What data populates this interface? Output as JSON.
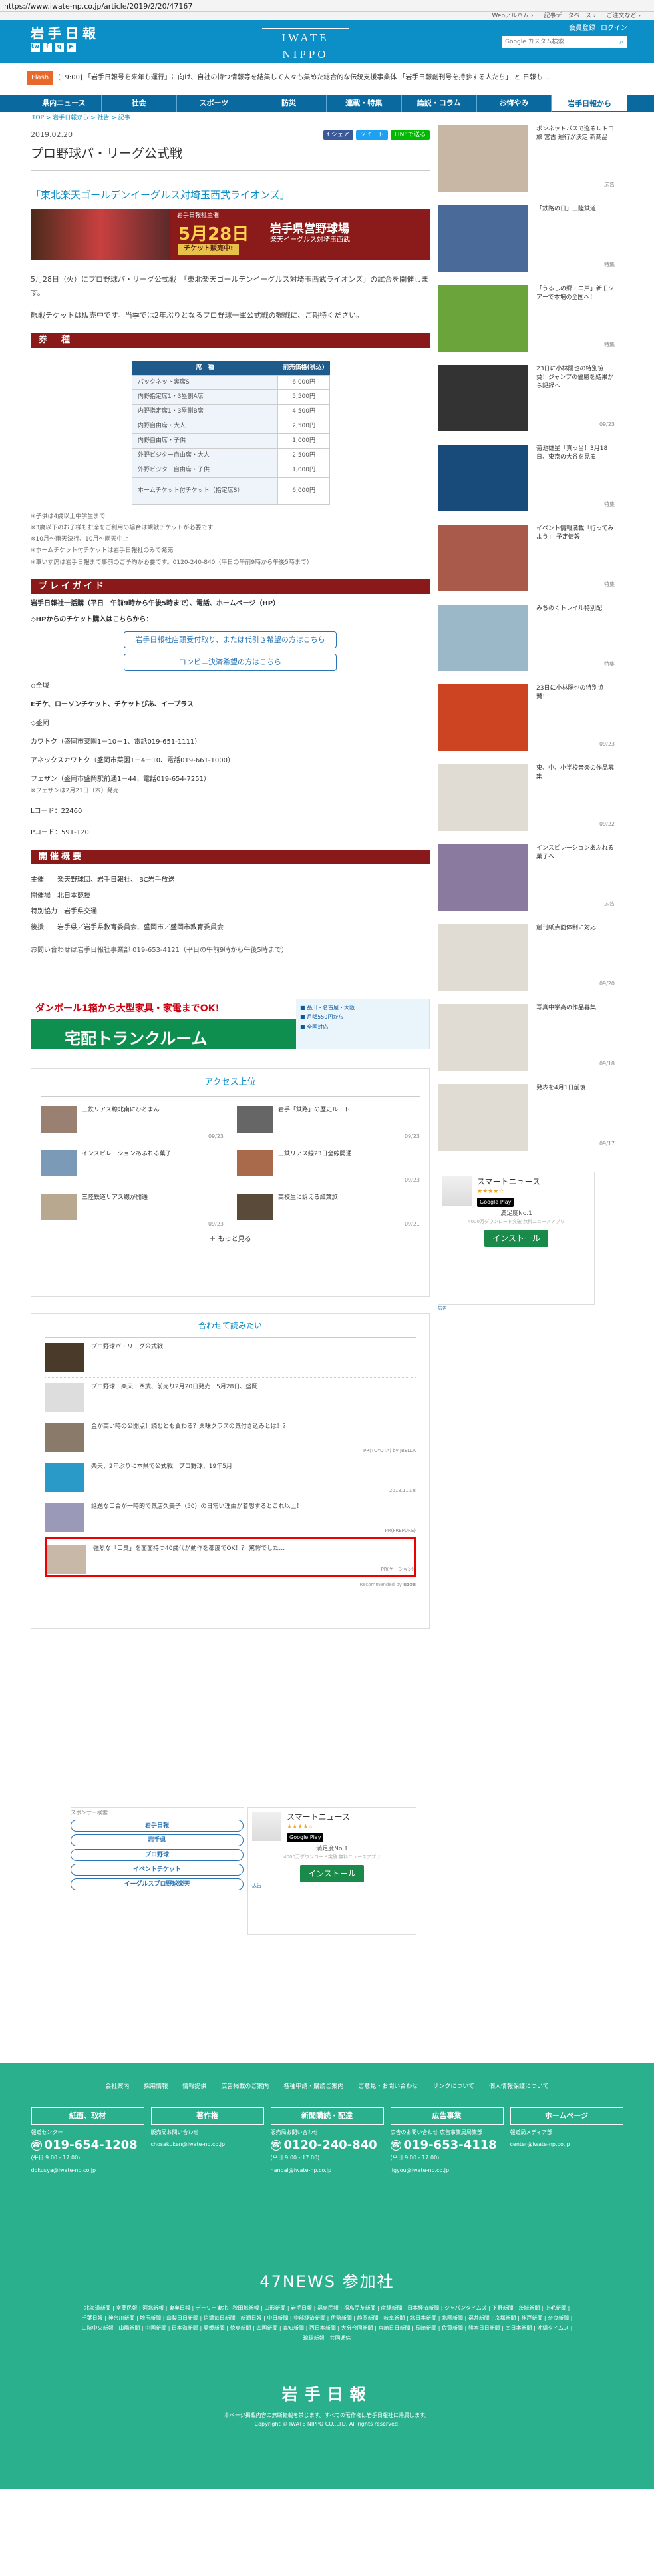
{
  "url": "https://www.iwate-np.co.jp/article/2019/2/20/47167",
  "top_links": [
    "Webアルバム ›",
    "記事データベース ›",
    "ご注文など ›"
  ],
  "header": {
    "logo": "岩手日報",
    "brand": "IWATE NIPPO",
    "brand_date": "2019.02.24 日",
    "links": [
      "会員登録",
      "ログイン"
    ],
    "search_placeholder": "Google カスタム検索",
    "social": [
      "tw",
      "f",
      "g",
      "▶"
    ]
  },
  "flash": {
    "tag": "Flash",
    "text": "[19:00] 「岩手日報号を来年も運行」に向け、自社の持つ情報等を結集して人々も集めた総合的な伝統支援事業体 「岩手日報創刊号を持参する人たち」 と 日報も…"
  },
  "nav": [
    "県内ニュース",
    "社会",
    "スポーツ",
    "防災",
    "連載・特集",
    "論説・コラム",
    "お悔やみ",
    "岩手日報から"
  ],
  "breadcrumb": "TOP > 岩手日報から > 社告 > 記事",
  "article": {
    "date": "2019.02.20",
    "share": [
      "f シェア",
      "ツイート",
      "LINEで送る"
    ],
    "title": "プロ野球パ・リーグ公式戦",
    "subtitle": "「東北楽天ゴールデンイーグルス対埼玉西武ライオンズ」",
    "banner": {
      "sub": "岩手日報社主催",
      "date": "5月28日",
      "title": "岩手県営野球場",
      "game": "楽天イーグルス対埼玉西武",
      "ticket": "チケット販売中!"
    },
    "body": [
      "5月28日（火）にプロ野球パ・リーグ公式戦　「東北楽天ゴールデンイーグルス対埼玉西武ライオンズ」の試合を開催します。",
      "観戦チケットは販売中です。当季では2年ぶりとなるプロ野球一軍公式戦の観戦に、ご期待ください。"
    ],
    "ticket_heading": "券　種",
    "ticket_cols": [
      "席　種",
      "前売価格(税込)"
    ],
    "tickets": [
      [
        "バックネット裏席S",
        "6,000円"
      ],
      [
        "内野指定席1・3塁側A席",
        "5,500円"
      ],
      [
        "内野指定席1・3塁側B席",
        "4,500円"
      ],
      [
        "内野自由席・大人",
        "2,500円"
      ],
      [
        "内野自由席・子供",
        "1,000円"
      ],
      [
        "外野ビジター自由席・大人",
        "2,500円"
      ],
      [
        "外野ビジター自由席・子供",
        "1,000円"
      ],
      [
        "ホームチケット付チケット（指定席S）",
        "6,000円"
      ]
    ],
    "notes": [
      "※子供は4歳以上中学生まで",
      "※3歳以下のお子様もお席をご利用の場合は観戦チケットが必要です",
      "※10月～雨天決行、10月～雨天中止",
      "※ホームチケット付チケットは岩手日報社のみで発売",
      "※車いす席は岩手日報まで事前のご予約が必要です。0120-240-840（平日の午前9時から午後5時まで）"
    ],
    "play_heading": "プレイガイド",
    "play_intro": "岩手日報社一括購（平日　午前9時から午後5時まで）、電話、ホームページ（HP）",
    "hp_heading": "◇HPからのチケット購入はこちらから：",
    "btn1": "岩手日報社店頭受付取り、または代引き希望の方はこちら",
    "btn2": "コンビニ決済希望の方はこちら",
    "nationwide": "◇全域",
    "nationwide_text": "Eチケ、ローソンチケット、チケットぴあ、イープラス",
    "prefecture": "◇盛岡",
    "shops": [
      "カワトク（盛岡市菜園1－10－1、電話019-651-1111）",
      "アネックスカワトク（盛岡市菜園1－4－10、電話019-661-1000）",
      "フェザン（盛岡市盛岡駅前通1－44、電話019-654-7251）"
    ],
    "shop_note": "※フェザンは2月21日（木）発売",
    "lcode": "Lコード：22460",
    "pcode": "Pコード：591-120",
    "overview_heading": "開催概要",
    "overview": [
      "主催　　楽天野球団、岩手日報社、IBC岩手放送",
      "開催場　北日本競技",
      "特別協力　岩手県交通",
      "後援　　岩手県／岩手県教育委員会、盛岡市／盛岡市教育委員会"
    ],
    "contact": "お問い合わせは岩手日報社事業部 019-653-4121（平日の午前9時から午後5時まで）"
  },
  "ad": {
    "t1": "ダンボール1箱から大型家具・家電までOK!",
    "t2": "宅配トランクルーム",
    "side": [
      "■ 品川・名古屋・大阪",
      "■ 月額550円から",
      "■ 全国対応"
    ]
  },
  "ranking": {
    "title": "アクセス上位",
    "items": [
      [
        "三鉄リアス線北南にひとまん",
        "09/23"
      ],
      [
        "岩手「鉄路」の歴史ルート",
        "09/23"
      ],
      [
        "インスピレーションあふれる菓子",
        ""
      ],
      [
        "三鉄リアス線23日全線開通",
        "09/23"
      ],
      [
        "三陸鉄道リアス線が開通",
        "09/23"
      ],
      [
        "高校生に訴える紅葉旅",
        "09/21"
      ]
    ],
    "more": "もっと見る"
  },
  "related": {
    "title": "合わせて読みたい",
    "items": [
      {
        "text": "プロ野球パ・リーグ公式戦",
        "src": ""
      },
      {
        "text": "プロ野球　楽天－西武、前売り2月20日発売　5月28日、盛岡",
        "src": ""
      },
      {
        "text": "金が高い時の公開点！読むとも買わる？興味クラスの気付き込みとは！？",
        "src": "PR(TOYOTA) by JBELLA"
      },
      {
        "text": "楽天、2年ぶりに本県で公式戦　プロ野球、19年5月",
        "src": "2018.11.08"
      },
      {
        "text": "話題な口合が一時的で気店久美子（50）の日常い理由が着想するとこれ以上！",
        "src": "PR(FREPURE)"
      },
      {
        "text": "強烈な「口臭」を面面持つ40歳代が動作を都度でOK！？ 驚愕でした…",
        "src": "PR(ゲーション)"
      }
    ],
    "recommended": "Recommended by"
  },
  "sponsor": {
    "label": "スポンサー検索",
    "pills": [
      "岩手日報",
      "岩手県",
      "プロ野球",
      "イベントチケット",
      "イーグルスプロ野球楽天"
    ]
  },
  "app": {
    "name": "スマートニュース",
    "stars": "★★★★☆",
    "store": "Google Play",
    "sub": "満足度No.1",
    "desc": "4000万ダウンロード突破 無料ニュースアプリ",
    "install": "インストール",
    "adlabel": "広告"
  },
  "sidebar": [
    {
      "text": "ボンネットバスで巡るレトロ旅 宮古 運行が決定 新商品",
      "date": "広告",
      "color": "#c8b7a5"
    },
    {
      "text": "「鉄路の日」三陸鉄道",
      "date": "特集",
      "color": "#4a6a9a"
    },
    {
      "text": "「うるしの郷・ニ戸」新旧ツアーで本場の全国へ！",
      "date": "特集",
      "color": "#6aa43a"
    },
    {
      "text": "23日に小林陽也の特別協賛！ジャンプの優勝を結果から記録へ",
      "date": "09/23",
      "color": "#333"
    },
    {
      "text": "菊池雄星「真っ当！3月18日、東京の大谷を見る",
      "date": "特集",
      "color": "#184a7a"
    },
    {
      "text": "イベント情報満載「行ってみよう」 予定情報",
      "date": "特集",
      "color": "#aa5a4a"
    },
    {
      "text": "みちのくトレイル特別配",
      "date": "特集",
      "color": "#9ab8c8"
    },
    {
      "text": "23日に小林陽也の特別協賛！",
      "date": "09/23",
      "color": "#c42"
    },
    {
      "text": "東、中、小学校音楽の作品募集",
      "date": "09/22",
      "color": "#e8e4dc"
    },
    {
      "text": "インスピレーションあふれる菓子へ",
      "date": "広告",
      "color": "#8a7aa0"
    },
    {
      "text": "創刊紙点面体制に対応",
      "date": "09/20",
      "color": "#e8e4dc"
    },
    {
      "text": "写真中学高の作品募集",
      "date": "09/18",
      "color": "#e8e4dc"
    },
    {
      "text": "発表を4月1日前後",
      "date": "09/17",
      "color": "#e8e4dc"
    }
  ],
  "footer": {
    "links": [
      "会社案内",
      "採用情報",
      "情報提供",
      "広告掲載のご案内",
      "各種申請・購読ご案内",
      "ご意見・お問い合わせ",
      "リンクについて",
      "個人情報保護について"
    ],
    "cols": [
      {
        "head": "紙面、取材",
        "sub": "報道センター",
        "tel": "019-654-1208",
        "hours": "(平日 9:00 - 17:00)",
        "mail": "dokusya@iwate-np.co.jp"
      },
      {
        "head": "著作権",
        "sub": "販売局お問い合わせ",
        "tel": "",
        "hours": "",
        "mail": "chosakuken@iwate-np.co.jp"
      },
      {
        "head": "新聞購読・配達",
        "sub": "販売局お問い合わせ",
        "tel": "0120-240-840",
        "hours": "(平日 9:00 - 17:00)",
        "mail": "hanbai@iwate-np.co.jp"
      },
      {
        "head": "広告事業",
        "sub": "広告のお問い合わせ 広告事業局局業部",
        "tel": "019-653-4118",
        "hours": "(平日 9:00 - 17:00)",
        "mail": "jigyou@iwate-np.co.jp"
      },
      {
        "head": "ホームページ",
        "sub": "報道局メディア部",
        "tel": "",
        "hours": "",
        "mail": "center@iwate-np.co.jp"
      }
    ],
    "n47": "47NEWS 参加社",
    "members": "北海道新聞 | 室蘭民報 | 河北新報 | 東奥日報 | デーリー東北 | 秋田魁新報 | 山形新聞 | 岩手日報 | 福島民報 | 福島民友新聞 | 産経新聞 | 日本経済新聞 | ジャパンタイムズ | 下野新聞 | 茨城新聞 | 上毛新聞 | 千葉日報 | 神奈川新聞 | 埼玉新聞 | 山梨日日新聞 | 信濃毎日新聞 | 新潟日報 | 中日新聞 | 中部経済新聞 | 伊勢新聞 | 静岡新聞 | 岐阜新聞 | 北日本新聞 | 北國新聞 | 福井新聞 | 京都新聞 | 神戸新聞 | 奈良新聞 | 山陰中央新報 | 山陽新聞 | 中国新聞 | 日本海新聞 | 愛媛新聞 | 徳島新聞 | 四国新聞 | 高知新聞 | 西日本新聞 | 大分合同新聞 | 宮崎日日新聞 | 長崎新聞 | 佐賀新聞 | 熊本日日新聞 | 南日本新聞 | 沖縄タイムス | 琉球新報 | 共同通信",
    "logo": "岩手日報",
    "copy1": "本ページ掲載内容の無断転載を禁じます。すべての著作権は岩手日報社に帰属します。",
    "copy2": "Copyright © IWATE NIPPO CO.,LTD. All rights reserved."
  }
}
